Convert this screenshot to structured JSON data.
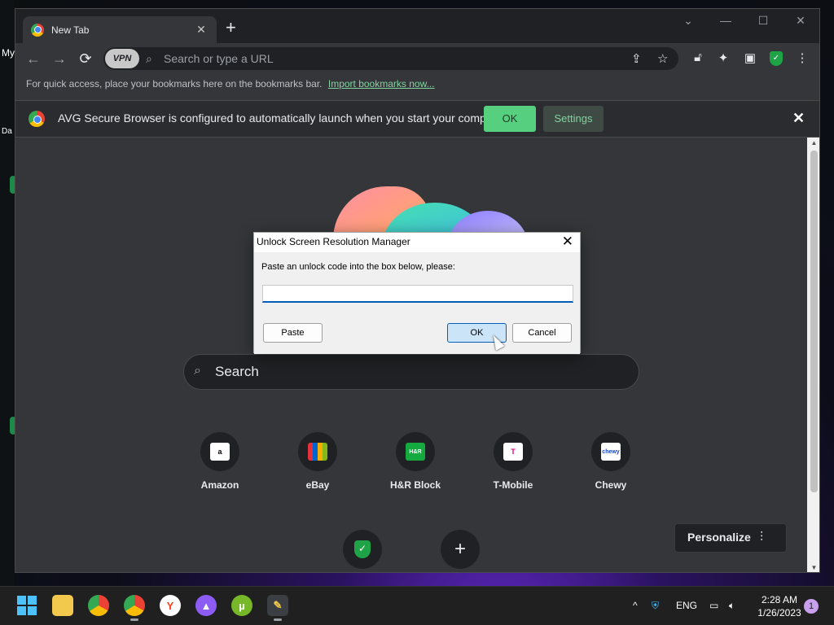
{
  "desktop": {
    "label_1": "My",
    "label_2": "Da"
  },
  "browser": {
    "tab": {
      "title": "New Tab",
      "close": "✕"
    },
    "new_tab": "+",
    "window_controls": {
      "dropdown": "⌄",
      "minimize": "—",
      "maximize": "☐",
      "close": "✕"
    },
    "toolbar": {
      "back": "←",
      "forward": "→",
      "reload": "⟳",
      "vpn_label": "VPN",
      "address_placeholder": "Search or type a URL"
    },
    "bookmarks_bar": {
      "hint": "For quick access, place your bookmarks here on the bookmarks bar.",
      "import_link": "Import bookmarks now..."
    },
    "infobar": {
      "message": "AVG Secure Browser is configured to automatically launch when you start your computer.",
      "ok": "OK",
      "settings": "Settings",
      "close": "✕"
    },
    "new_tab_page": {
      "search_label": "Search",
      "shortcuts": [
        {
          "label": "Amazon",
          "logo_text": "a",
          "logo_bg": "#ffffff",
          "logo_color": "#000000"
        },
        {
          "label": "eBay",
          "logo_text": "",
          "logo_bg": "#e53238",
          "logo_color": "#ffffff"
        },
        {
          "label": "H&R Block",
          "logo_text": "H&R",
          "logo_bg": "#14aa40",
          "logo_color": "#ffffff"
        },
        {
          "label": "T-Mobile",
          "logo_text": "T",
          "logo_bg": "#ffffff",
          "logo_color": "#e20074"
        },
        {
          "label": "Chewy",
          "logo_text": "chewy",
          "logo_bg": "#ffffff",
          "logo_color": "#1c49c2"
        }
      ],
      "add_shortcut": "+",
      "personalize": "Personalize"
    }
  },
  "dialog": {
    "title": "Unlock Screen Resolution Manager",
    "message": "Paste an unlock code into the box below, please:",
    "input_value": "",
    "paste": "Paste",
    "ok": "OK",
    "cancel": "Cancel",
    "close": "✕"
  },
  "taskbar": {
    "tray": {
      "language": "ENG",
      "chevron": "^"
    },
    "clock": {
      "time": "2:28 AM",
      "date": "1/26/2023"
    },
    "notifications": "1"
  },
  "colors": {
    "accent_green": "#56d07f",
    "link_green": "#81d4a0",
    "dialog_focus": "#005fb8"
  }
}
